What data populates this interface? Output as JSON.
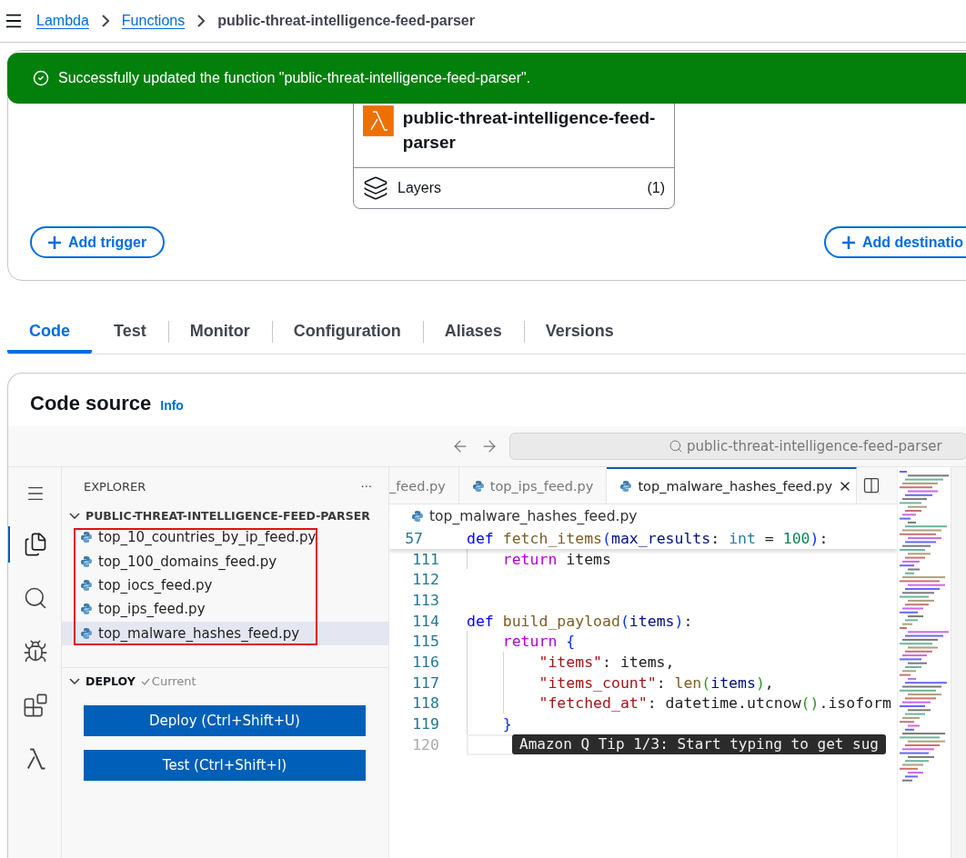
{
  "breadcrumbs": [
    {
      "label": "Lambda",
      "kind": "link"
    },
    {
      "label": "Functions",
      "kind": "link"
    },
    {
      "label": "public-threat-intelligence-feed-parser",
      "kind": "current"
    }
  ],
  "flash": {
    "message": "Successfully updated the function \"public-threat-intelligence-feed-parser\"."
  },
  "function_box": {
    "name": "public-threat-intelligence-feed-parser",
    "layers_label": "Layers",
    "layers_count": "(1)"
  },
  "trigger_button": "Add trigger",
  "destination_button": "Add destinatio",
  "tabs": [
    {
      "label": "Code",
      "selected": true
    },
    {
      "label": "Test",
      "selected": false
    },
    {
      "label": "Monitor",
      "selected": false
    },
    {
      "label": "Configuration",
      "selected": false
    },
    {
      "label": "Aliases",
      "selected": false
    },
    {
      "label": "Versions",
      "selected": false
    }
  ],
  "code_source": {
    "title": "Code source",
    "info": "Info"
  },
  "editor": {
    "search": "public-threat-intelligence-feed-parser",
    "activity": [
      {
        "kind": "menu",
        "selected": false
      },
      {
        "kind": "files",
        "selected": true
      },
      {
        "kind": "search",
        "selected": false
      },
      {
        "kind": "debug",
        "selected": false
      },
      {
        "kind": "extensions",
        "selected": false
      },
      {
        "kind": "lambda",
        "selected": false
      }
    ],
    "explorer": {
      "title": "EXPLORER",
      "more": "···",
      "folder": "PUBLIC-THREAT-INTELLIGENCE-FEED-PARSER",
      "expanded": true,
      "highlighted": true,
      "files": [
        {
          "name": "top_10_countries_by_ip_feed.py",
          "selected": false
        },
        {
          "name": "top_100_domains_feed.py",
          "selected": false
        },
        {
          "name": "top_iocs_feed.py",
          "selected": false
        },
        {
          "name": "top_ips_feed.py",
          "selected": false
        },
        {
          "name": "top_malware_hashes_feed.py",
          "selected": true
        }
      ]
    },
    "deploy": {
      "title": "DEPLOY",
      "status": "Current",
      "expanded": true,
      "buttons": [
        "Deploy (Ctrl+Shift+U)",
        "Test (Ctrl+Shift+I)"
      ]
    },
    "tabs": [
      {
        "label": "_feed.py",
        "icon": false,
        "selected": false
      },
      {
        "label": "top_ips_feed.py",
        "icon": true,
        "selected": false
      },
      {
        "label": "top_malware_hashes_feed.py",
        "icon": true,
        "selected": true
      }
    ],
    "file_breadcrumb": "top_malware_hashes_feed.py",
    "sticky_line": {
      "number": "57",
      "tokens": [
        {
          "kind": "kw",
          "text": "def "
        },
        {
          "kind": "fn",
          "text": "fetch_items"
        },
        {
          "kind": "br1",
          "text": "("
        },
        {
          "kind": "param",
          "text": "max_results"
        },
        {
          "kind": "plain",
          "text": ": "
        },
        {
          "kind": "type",
          "text": "int"
        },
        {
          "kind": "plain",
          "text": " = "
        },
        {
          "kind": "num",
          "text": "100"
        },
        {
          "kind": "br1",
          "text": ")"
        },
        {
          "kind": "plain",
          "text": ":"
        }
      ]
    },
    "lines": [
      {
        "number": "111",
        "tokens": [
          {
            "kind": "ctrl",
            "text": "    return"
          },
          {
            "kind": "plain",
            "text": " items"
          }
        ]
      },
      {
        "number": "112"
      },
      {
        "number": "113"
      },
      {
        "number": "114",
        "tokens": [
          {
            "kind": "kw",
            "text": "def "
          },
          {
            "kind": "fn",
            "text": "build_payload"
          },
          {
            "kind": "br1",
            "text": "("
          },
          {
            "kind": "param",
            "text": "items"
          },
          {
            "kind": "br1",
            "text": ")"
          },
          {
            "kind": "plain",
            "text": ":"
          }
        ]
      },
      {
        "number": "115",
        "tokens": [
          {
            "kind": "ctrl",
            "text": "    return "
          },
          {
            "kind": "br1",
            "text": "{"
          }
        ]
      },
      {
        "number": "116",
        "tokens": [
          {
            "kind": "str",
            "text": "        \"items\""
          },
          {
            "kind": "plain",
            "text": ": items,"
          }
        ]
      },
      {
        "number": "117",
        "tokens": [
          {
            "kind": "str",
            "text": "        \"items_count\""
          },
          {
            "kind": "plain",
            "text": ": "
          },
          {
            "kind": "fn",
            "text": "len"
          },
          {
            "kind": "br2",
            "text": "("
          },
          {
            "kind": "param",
            "text": "items"
          },
          {
            "kind": "br2",
            "text": ")"
          },
          {
            "kind": "plain",
            "text": ","
          }
        ]
      },
      {
        "number": "118",
        "tokens": [
          {
            "kind": "str",
            "text": "        \"fetched_at\""
          },
          {
            "kind": "plain",
            "text": ": datetime.utcnow"
          },
          {
            "kind": "br2",
            "text": "()"
          },
          {
            "kind": "plain",
            "text": ".isoform"
          }
        ]
      },
      {
        "number": "119",
        "tokens": [
          {
            "kind": "br1",
            "text": "    }"
          }
        ]
      },
      {
        "number": "120",
        "current": true
      }
    ],
    "tip": "Amazon Q Tip 1/3: Start typing to get sug"
  }
}
